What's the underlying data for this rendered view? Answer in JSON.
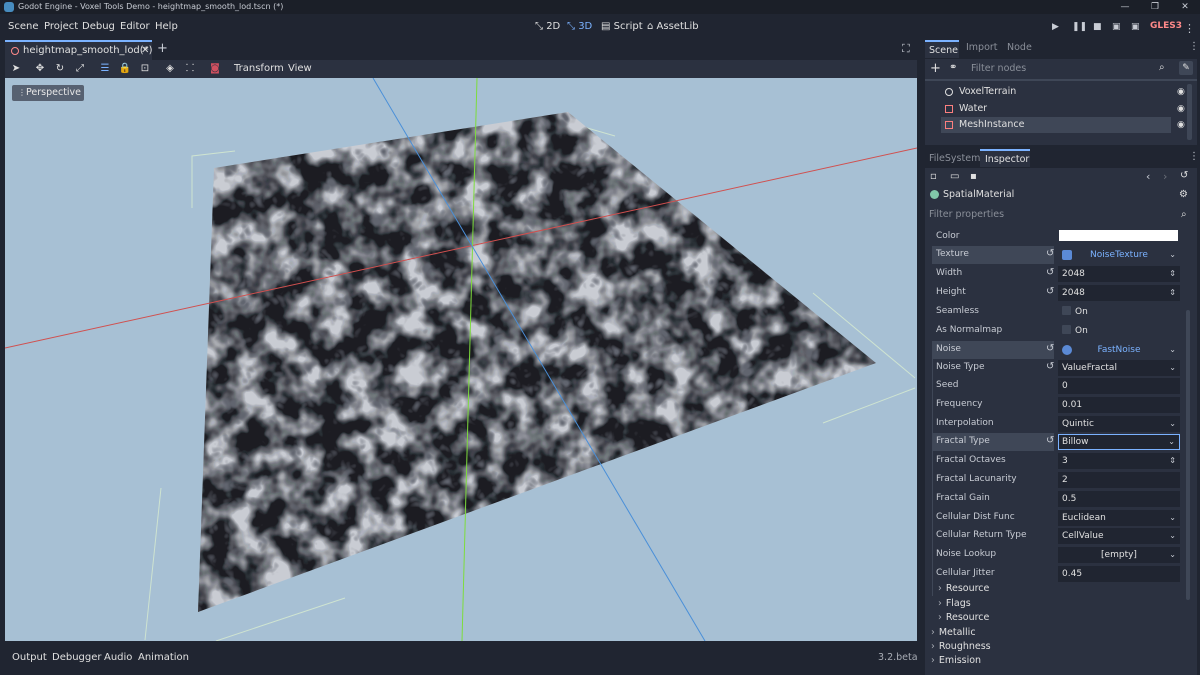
{
  "window": {
    "title": "Godot Engine - Voxel Tools Demo - heightmap_smooth_lod.tscn (*)",
    "minimize": "—",
    "restore": "❐",
    "close": "✕"
  },
  "menubar": {
    "menus": [
      "Scene",
      "Project",
      "Debug",
      "Editor",
      "Help"
    ],
    "modes": [
      "2D",
      "3D",
      "Script",
      "AssetLib"
    ],
    "active_mode": "3D",
    "renderer": "GLES3"
  },
  "editor_tabs": {
    "scene_tab": "heightmap_smooth_lod(*)",
    "close_glyph": "✕",
    "new_tab_glyph": "+"
  },
  "viewport_toolbar": {
    "menus": [
      "Transform",
      "View"
    ]
  },
  "viewport": {
    "perspective_label": "Perspective",
    "sky_color": "#a7c0d4",
    "x_axis_color": "#d0504f",
    "y_axis_color": "#7ddc3c",
    "z_axis_color": "#4a8fd8"
  },
  "bottom_panel": {
    "tabs": [
      "Output",
      "Debugger",
      "Audio",
      "Animation"
    ],
    "version": "3.2.beta"
  },
  "scene_dock": {
    "tabs": [
      "Scene",
      "Import",
      "Node"
    ],
    "active_tab": "Scene",
    "filter_placeholder": "Filter nodes",
    "nodes": [
      {
        "name": "VoxelTerrain",
        "icon": "voxel-terrain-icon",
        "selected": false
      },
      {
        "name": "Water",
        "icon": "mesh-instance-icon",
        "selected": false
      },
      {
        "name": "MeshInstance",
        "icon": "mesh-instance-icon",
        "selected": true
      }
    ]
  },
  "inspector_dock": {
    "tabs": [
      "FileSystem",
      "Inspector"
    ],
    "active_tab": "Inspector",
    "resource_name": "SpatialMaterial",
    "filter_placeholder": "Filter properties",
    "properties": [
      {
        "label": "Color",
        "value": "",
        "kind": "color",
        "swatch": "#ffffff"
      },
      {
        "label": "Texture",
        "value": "NoiseTexture",
        "kind": "resource",
        "highlight": true,
        "revert": true
      },
      {
        "label": "Width",
        "value": "2048",
        "kind": "spin",
        "revert": true
      },
      {
        "label": "Height",
        "value": "2048",
        "kind": "spin",
        "revert": true
      },
      {
        "label": "Seamless",
        "value": "On",
        "kind": "check"
      },
      {
        "label": "As Normalmap",
        "value": "On",
        "kind": "check"
      },
      {
        "label": "Noise",
        "value": "FastNoise",
        "kind": "resource",
        "highlight": true,
        "revert": true
      },
      {
        "label": "Noise Type",
        "value": "ValueFractal",
        "kind": "dropdown",
        "revert": true
      },
      {
        "label": "Seed",
        "value": "0",
        "kind": "text"
      },
      {
        "label": "Frequency",
        "value": "0.01",
        "kind": "text"
      },
      {
        "label": "Interpolation",
        "value": "Quintic",
        "kind": "dropdown"
      },
      {
        "label": "Fractal Type",
        "value": "Billow",
        "kind": "dropdown",
        "highlight": true,
        "revert": true,
        "focused": true
      },
      {
        "label": "Fractal Octaves",
        "value": "3",
        "kind": "spin"
      },
      {
        "label": "Fractal Lacunarity",
        "value": "2",
        "kind": "text"
      },
      {
        "label": "Fractal Gain",
        "value": "0.5",
        "kind": "text"
      },
      {
        "label": "Cellular Dist Func",
        "value": "Euclidean",
        "kind": "dropdown"
      },
      {
        "label": "Cellular Return Type",
        "value": "CellValue",
        "kind": "dropdown"
      },
      {
        "label": "Noise Lookup",
        "value": "[empty]",
        "kind": "dropdown-center"
      },
      {
        "label": "Cellular Jitter",
        "value": "0.45",
        "kind": "text"
      }
    ],
    "sections": [
      "Resource",
      "Flags",
      "Resource",
      "Metallic",
      "Roughness",
      "Emission"
    ]
  },
  "colors": {
    "accent": "#7bb2ff",
    "panel_bg": "#202531",
    "panel_light": "#2b3140",
    "highlight": "#3f4757"
  }
}
